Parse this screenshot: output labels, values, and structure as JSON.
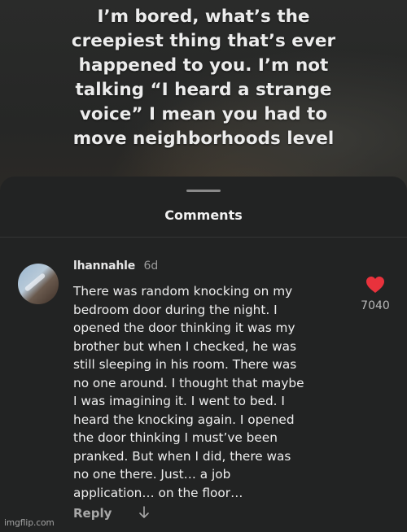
{
  "caption_lines": [
    "I’m bored, what’s the",
    "creepiest thing that’s ever",
    "happened to you. I’m not",
    "talking “I heard a strange",
    "voice” I mean you had to",
    "move neighborhoods level"
  ],
  "comments_sheet": {
    "title": "Comments",
    "comment": {
      "username": "lhannahle",
      "age": "6d",
      "text_lines": [
        "There was random knocking on my",
        "bedroom door during the night. I",
        "opened the door thinking it was my",
        "brother but when I checked, he was",
        "still sleeping in his room. There was",
        "no one around. I thought that maybe",
        "I was imagining it. I went to bed. I",
        "heard the knocking again. I opened",
        "the door thinking I must’ve been",
        "pranked. But when I did, there was",
        "no one there. Just… a job",
        "application… on the floor…"
      ],
      "like_count": "7040",
      "liked": true,
      "reply_label": "Reply",
      "expand_icon": "arrow-down-icon"
    }
  },
  "watermark": "imgflip.com",
  "colors": {
    "heart": "#e8323c",
    "sheet_bg": "#222323",
    "text": "#eeeeee",
    "muted": "#9a9a9a"
  }
}
